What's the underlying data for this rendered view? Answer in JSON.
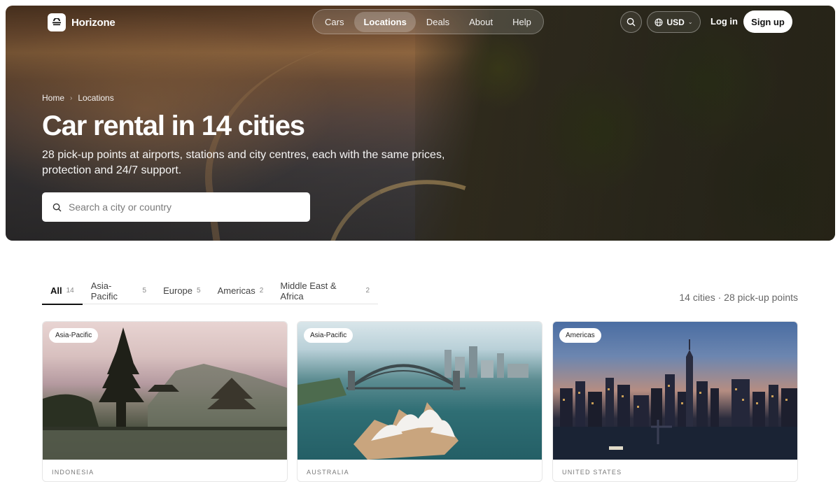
{
  "brand": {
    "name": "Horizone"
  },
  "nav": {
    "items": [
      {
        "label": "Cars",
        "active": false
      },
      {
        "label": "Locations",
        "active": true
      },
      {
        "label": "Deals",
        "active": false
      },
      {
        "label": "About",
        "active": false
      },
      {
        "label": "Help",
        "active": false
      }
    ],
    "currency": "USD",
    "login_label": "Log in",
    "signup_label": "Sign up"
  },
  "hero": {
    "breadcrumb": [
      "Home",
      "Locations"
    ],
    "title": "Car rental in 14 cities",
    "subtitle": "28 pick-up points at airports, stations and city centres, each with the same prices, protection and 24/7 support.",
    "search_placeholder": "Search a city or country"
  },
  "filters": {
    "tabs": [
      {
        "label": "All",
        "count": "14",
        "active": true
      },
      {
        "label": "Asia-Pacific",
        "count": "5",
        "active": false
      },
      {
        "label": "Europe",
        "count": "5",
        "active": false
      },
      {
        "label": "Americas",
        "count": "2",
        "active": false
      },
      {
        "label": "Middle East & Africa",
        "count": "2",
        "active": false
      }
    ],
    "summary": "14 cities · 28 pick-up points"
  },
  "cards": [
    {
      "region": "Asia-Pacific",
      "country": "INDONESIA",
      "scene": "temple-lake"
    },
    {
      "region": "Asia-Pacific",
      "country": "AUSTRALIA",
      "scene": "harbour-bridge"
    },
    {
      "region": "Americas",
      "country": "UNITED STATES",
      "scene": "city-skyline"
    }
  ],
  "colors": {
    "accent": "#111111",
    "hero_overlay": "#000000",
    "page_bg": "#ffffff"
  },
  "icons": {
    "logo": "stripes-logo-icon",
    "search": "search-icon",
    "currency": "globe-icon",
    "chevron": "chevron-down-icon",
    "breadcrumb_sep": "chevron-right-icon"
  }
}
